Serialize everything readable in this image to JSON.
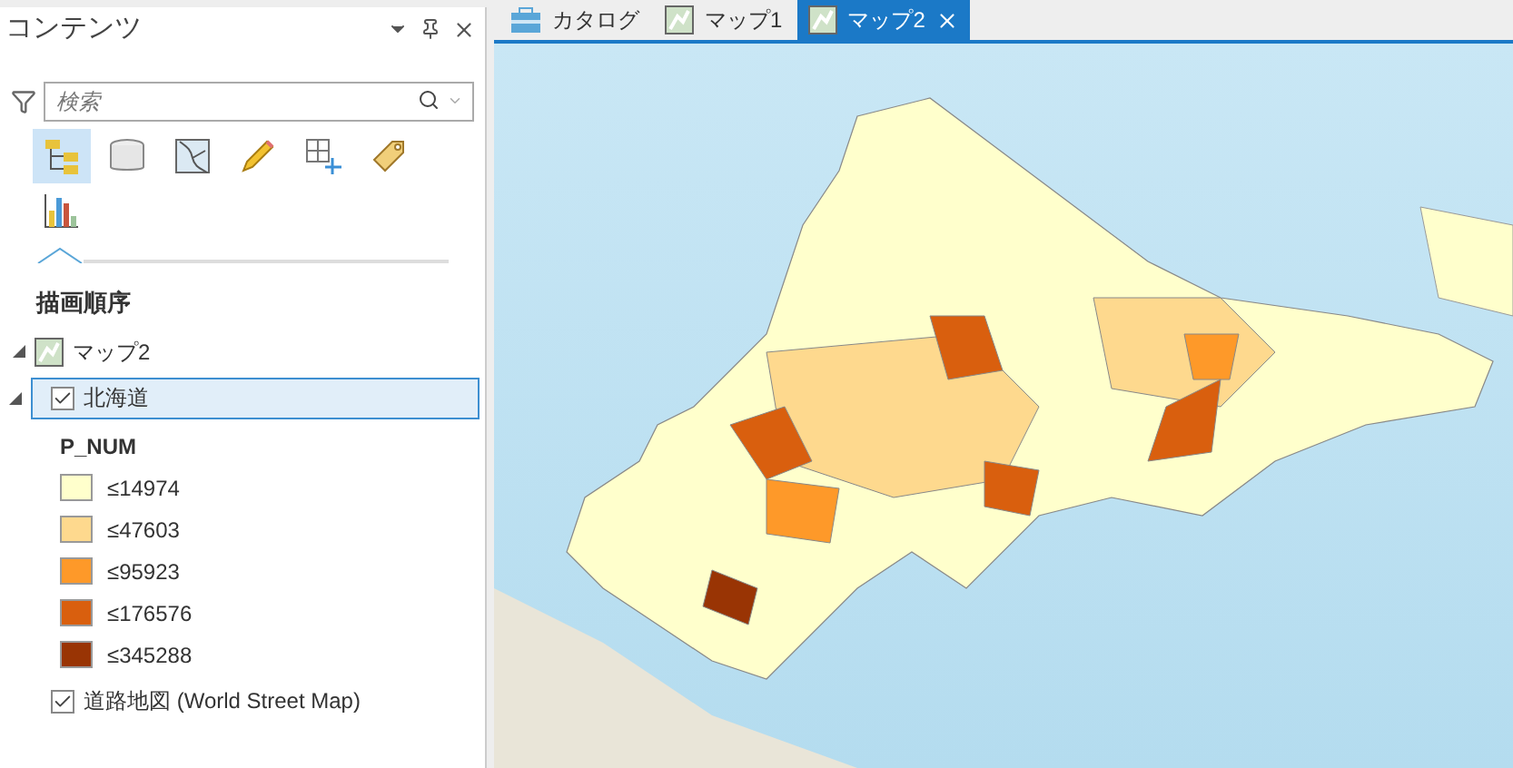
{
  "panel": {
    "title": "コンテンツ",
    "search": {
      "placeholder": "検索"
    },
    "toolbar": [
      {
        "kind": "drawing-order",
        "selected": true
      },
      {
        "kind": "source",
        "selected": false
      },
      {
        "kind": "selection",
        "selected": false
      },
      {
        "kind": "editing",
        "selected": false
      },
      {
        "kind": "snapping",
        "selected": false
      },
      {
        "kind": "labeling",
        "selected": false
      },
      {
        "kind": "charts",
        "selected": false
      }
    ],
    "heading": "描画順序",
    "map": {
      "name": "マップ2",
      "expanded": true
    },
    "layers": [
      {
        "name": "北海道",
        "checked": true,
        "selected": true,
        "expanded": true,
        "field": "P_NUM",
        "classes": [
          {
            "label": "≤14974",
            "color": "#ffffcc"
          },
          {
            "label": "≤47603",
            "color": "#fed98e"
          },
          {
            "label": "≤95923",
            "color": "#fe9929"
          },
          {
            "label": "≤176576",
            "color": "#d95f0e"
          },
          {
            "label": "≤345288",
            "color": "#993404"
          }
        ]
      },
      {
        "name": "道路地図 (World Street Map)",
        "checked": true,
        "selected": false
      }
    ]
  },
  "tabs": [
    {
      "label": "カタログ",
      "kind": "catalog",
      "selected": false
    },
    {
      "label": "マップ1",
      "kind": "map",
      "selected": false
    },
    {
      "label": "マップ2",
      "kind": "map",
      "selected": true
    }
  ]
}
